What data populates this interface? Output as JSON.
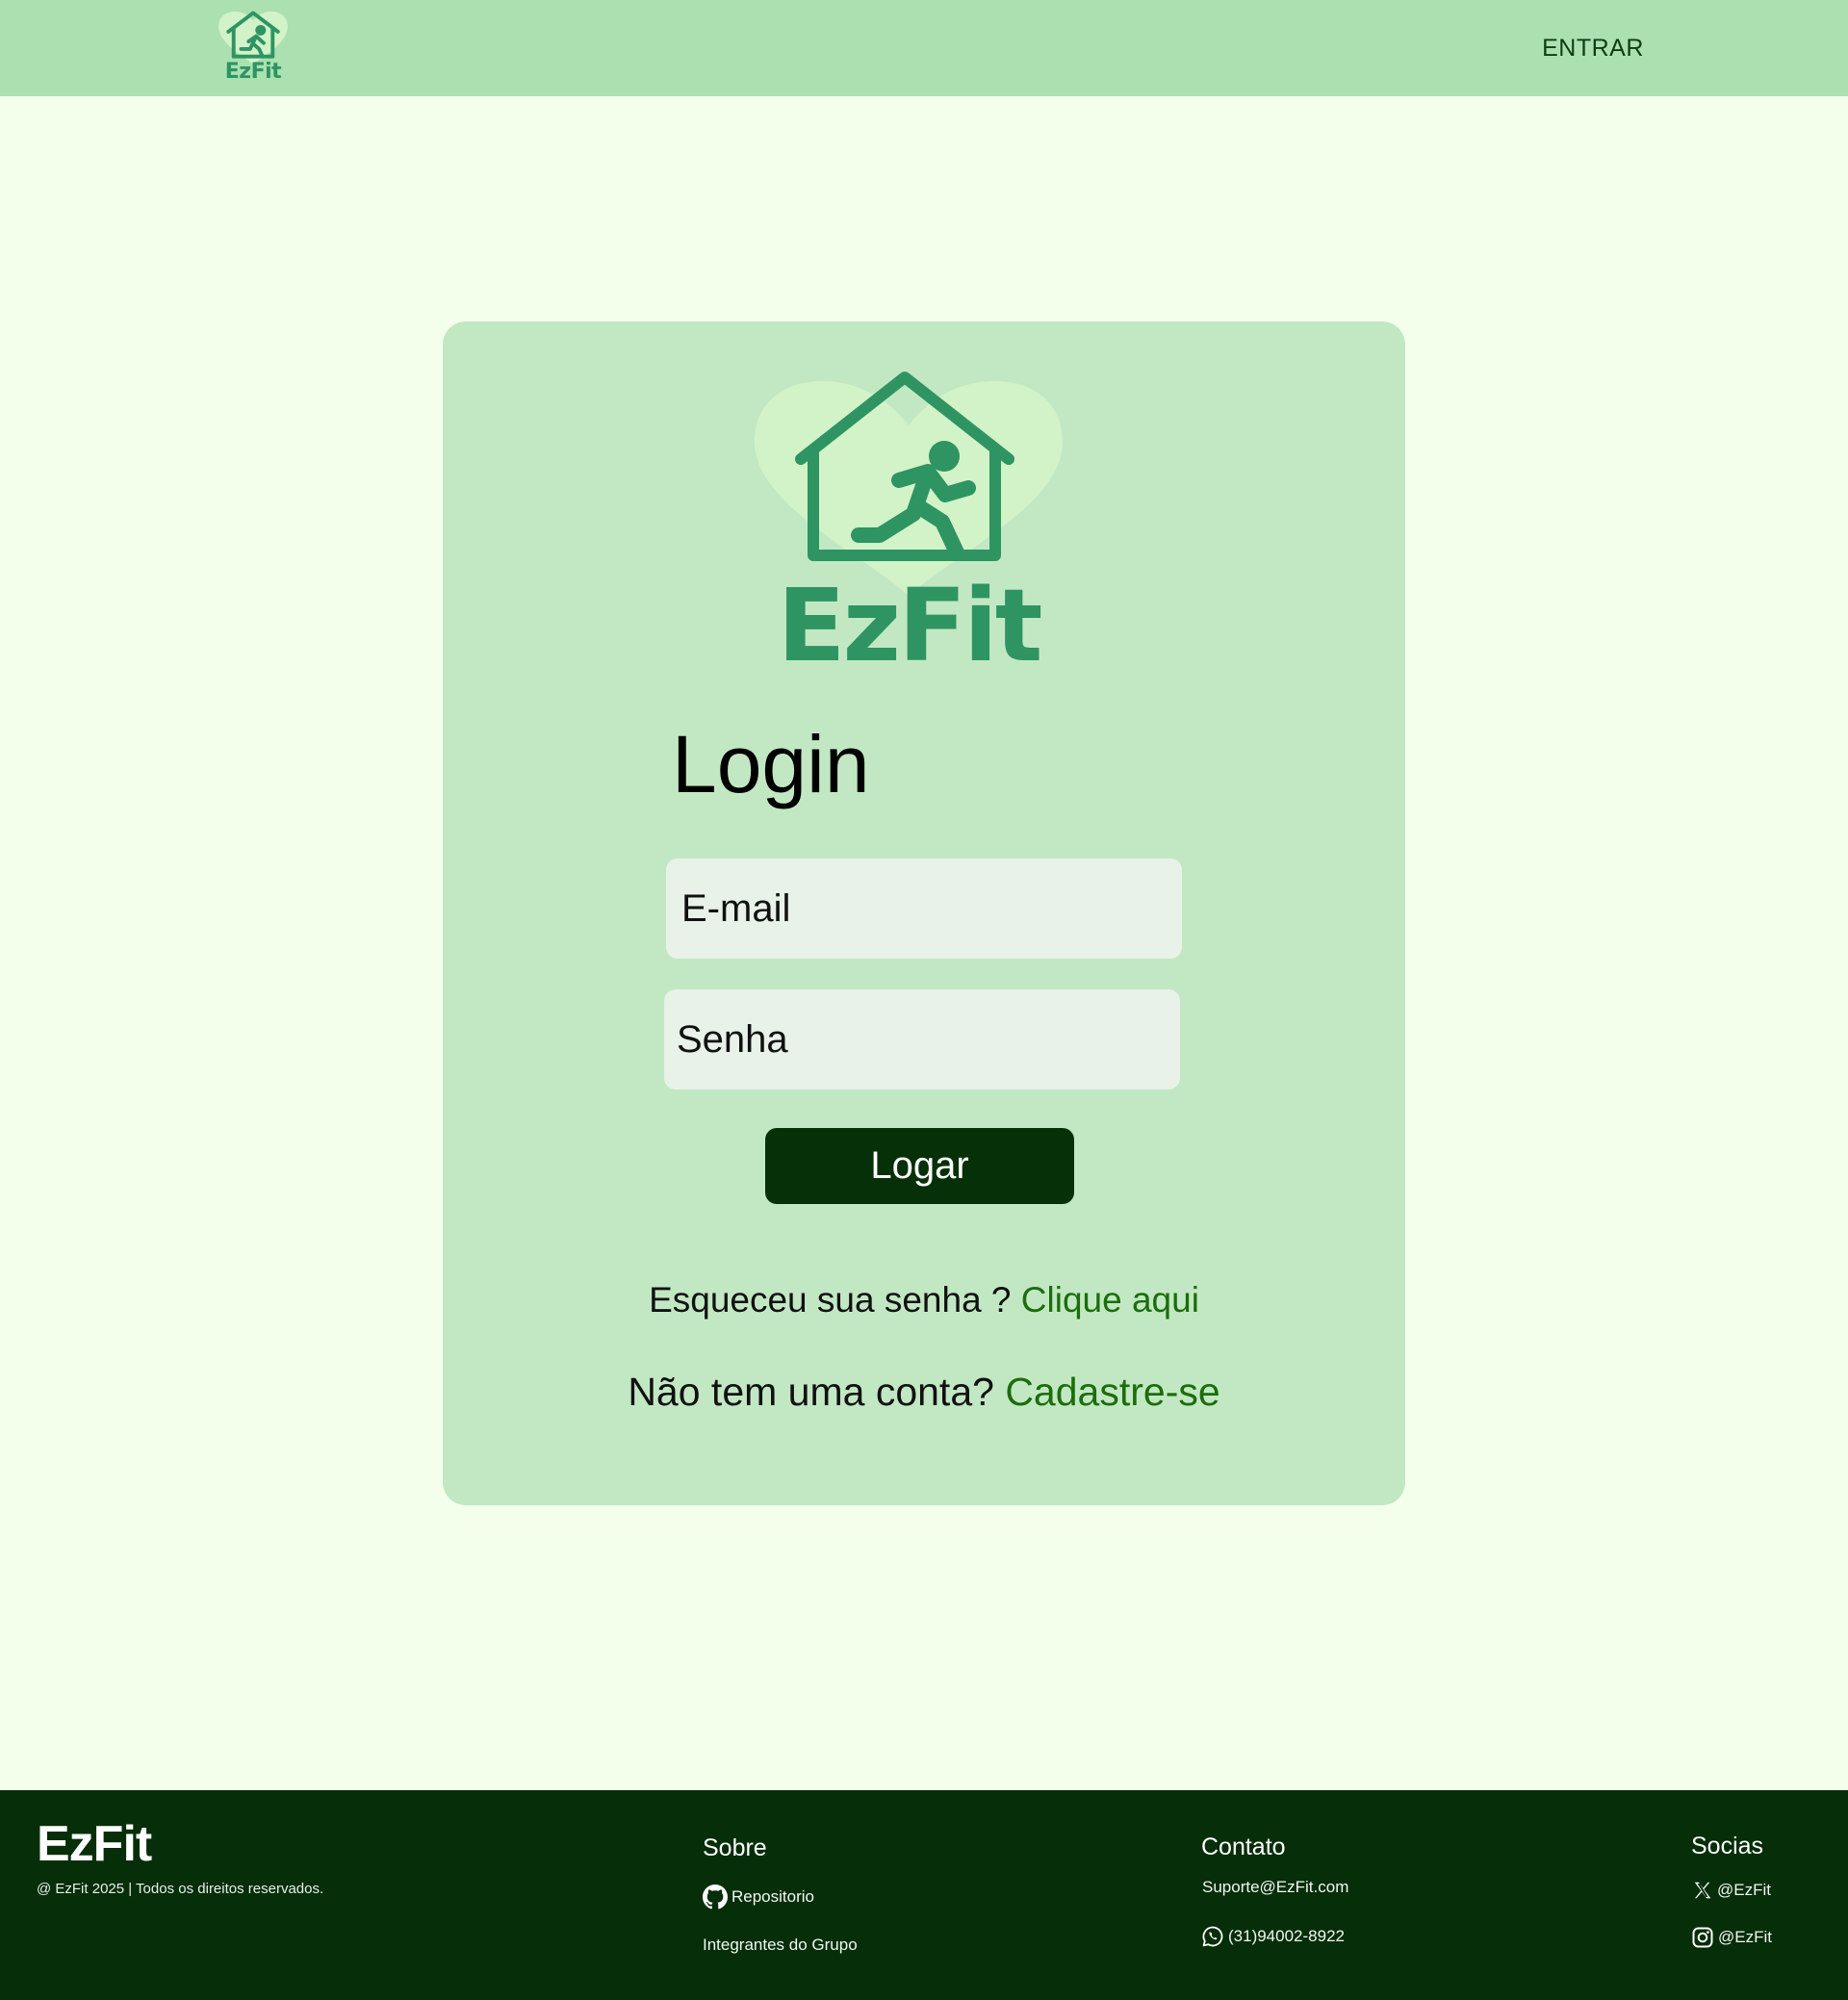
{
  "header": {
    "logo_text": "EzFit",
    "nav_enter": "ENTRAR"
  },
  "login": {
    "logo_text": "EzFit",
    "title": "Login",
    "email_placeholder": "E-mail",
    "password_placeholder": "Senha",
    "submit_label": "Logar",
    "forgot_text": "Esqueceu sua senha ?",
    "forgot_link": "Clique aqui",
    "signup_text": "Não tem uma conta?",
    "signup_link": "Cadastre-se"
  },
  "footer": {
    "brand": "EzFit",
    "copyright": "@ EzFit 2025 | Todos os direitos reservados.",
    "about": {
      "heading": "Sobre",
      "repo_label": "Repositorio",
      "members_label": "Integrantes do Grupo"
    },
    "contact": {
      "heading": "Contato",
      "email": "Suporte@EzFit.com",
      "phone": "(31)94002-8922"
    },
    "social": {
      "heading": "Socias",
      "x_handle": "@EzFit",
      "instagram_handle": "@EzFit"
    }
  },
  "icons": {
    "brand_logo": "house-runner-heart-icon",
    "repo": "github-icon",
    "phone": "whatsapp-icon",
    "x": "x-icon",
    "instagram": "instagram-icon"
  },
  "colors": {
    "page_background": "#f4ffeb",
    "header_background": "#abe0b1",
    "card_background": "#c2e8c3",
    "logo_green": "#2e9462",
    "logo_heart": "#d2f2c8",
    "input_background": "#e8f2e8",
    "button_background": "#063008",
    "link_green": "#1c6d0c",
    "footer_background": "#052e09"
  }
}
